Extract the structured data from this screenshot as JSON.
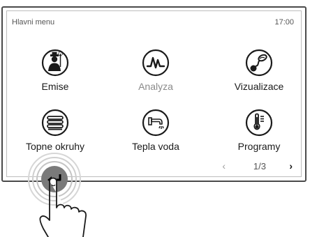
{
  "header": {
    "title": "Hlavni menu",
    "time": "17:00"
  },
  "tiles": [
    {
      "label": "Emise",
      "icon": "chimney-sweep-icon"
    },
    {
      "label": "Analyza",
      "icon": "analysis-wave-icon",
      "disabled": true
    },
    {
      "label": "Vizualizace",
      "icon": "visualization-icon"
    },
    {
      "label": "Topne okruhy",
      "icon": "heating-circuit-icon"
    },
    {
      "label": "Tepla voda",
      "icon": "hot-water-tap-icon"
    },
    {
      "label": "Programy",
      "icon": "thermometer-icon"
    }
  ],
  "pager": {
    "prev": "‹",
    "page": "1/3",
    "next": "›"
  },
  "back_button": {
    "icon": "back-arrow-icon"
  },
  "colors": {
    "icon_stroke": "#1a1a1a",
    "frame": "#4a4a4a",
    "touch_ring": "#c9c9c9"
  }
}
